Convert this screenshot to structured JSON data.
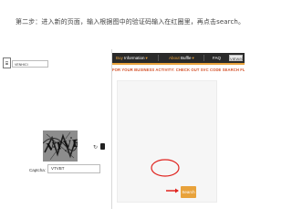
{
  "instruction": "第二步：进入新的页面，输入根据图中的验证码输入在红圈里，再点击search。",
  "nav": {
    "items": [
      {
        "prefix": "Buy",
        "label": "Information"
      },
      {
        "prefix": "About",
        "label": "Buffle"
      },
      {
        "prefix": "",
        "label": "FAQ"
      }
    ],
    "corner_button": "VIEW/ICH"
  },
  "tagline": "FOR YOUR BUSINESS ACTIVITY: CHECK OUT SVC CODE SEARCH FUNCTION",
  "vin": {
    "value": "VENHICI"
  },
  "captcha": {
    "text": "VTVBT",
    "label": "Captcha:",
    "input_value": "VTVBT"
  },
  "search_button": "Search",
  "colors": {
    "accent": "#e8a23b",
    "nav_bg": "#2a2a2a",
    "highlight": "#e0231e",
    "tagline": "#d4522a"
  },
  "icons": {
    "refresh": "refresh-icon",
    "audio": "audio-icon",
    "vin": "vin-icon"
  }
}
